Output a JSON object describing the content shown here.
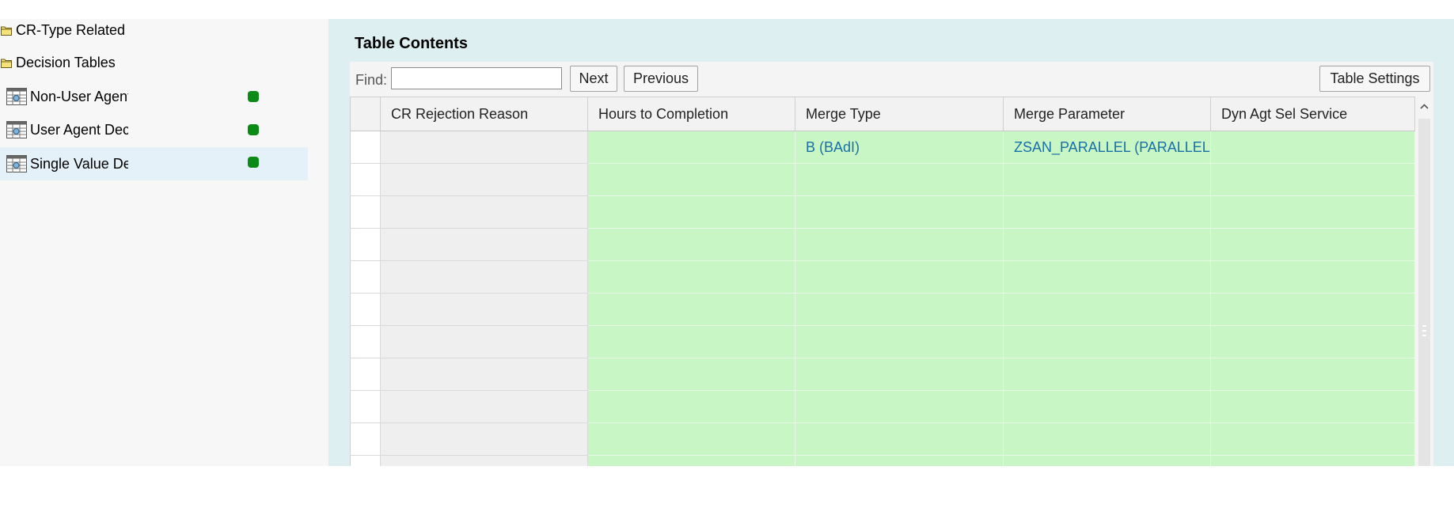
{
  "tree": {
    "items": [
      {
        "label": "CR-Type Related",
        "type": "folder"
      },
      {
        "label": "Decision Tables",
        "type": "folder"
      },
      {
        "label": "Non-User Agent Decision Table",
        "type": "table",
        "status_color": "#0c8a16"
      },
      {
        "label": "User Agent Decision Table",
        "type": "table",
        "status_color": "#0c8a16"
      },
      {
        "label": "Single Value Decision Table",
        "type": "table",
        "status_color": "#0c8a16",
        "selected": true
      }
    ]
  },
  "panel": {
    "title": "Table Contents",
    "find_label": "Find:",
    "find_value": "",
    "next_label": "Next",
    "previous_label": "Previous",
    "settings_label": "Table Settings"
  },
  "table": {
    "columns": [
      "CR Rejection Reason",
      "Hours to Completion",
      "Merge Type",
      "Merge Parameter",
      "Dyn Agt Sel Service"
    ],
    "rows": [
      [
        "",
        "",
        "B (BAdI)",
        "ZSAN_PARALLEL (PARALLEL)",
        ""
      ],
      [
        "",
        "",
        "",
        "",
        ""
      ],
      [
        "",
        "",
        "",
        "",
        ""
      ],
      [
        "",
        "",
        "",
        "",
        ""
      ],
      [
        "",
        "",
        "",
        "",
        ""
      ],
      [
        "",
        "",
        "",
        "",
        ""
      ],
      [
        "",
        "",
        "",
        "",
        ""
      ],
      [
        "",
        "",
        "",
        "",
        ""
      ],
      [
        "",
        "",
        "",
        "",
        ""
      ],
      [
        "",
        "",
        "",
        "",
        ""
      ],
      [
        "",
        "",
        "",
        "",
        ""
      ]
    ]
  },
  "colors": {
    "editable_cell": "#c8f7c5",
    "readonly_cell": "#efefef",
    "link_text": "#1a6fa8",
    "panel_background": "#deeff2"
  }
}
